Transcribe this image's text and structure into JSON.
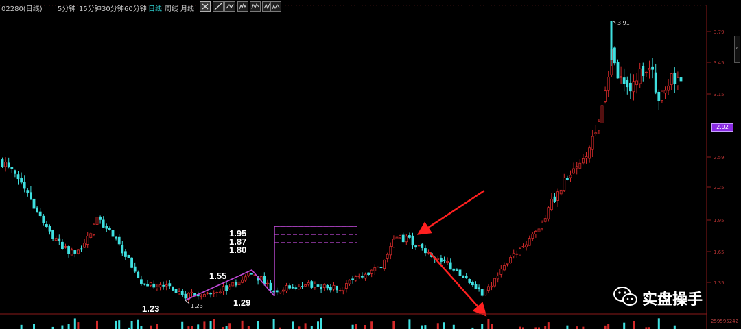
{
  "header": {
    "symbol_label": "02280(日线)",
    "periods": [
      {
        "label": "5分钟",
        "active": false
      },
      {
        "label": "15分钟",
        "active": false
      },
      {
        "label": "30分钟",
        "active": false
      },
      {
        "label": "60分钟",
        "active": false
      },
      {
        "label": "日线",
        "active": true
      },
      {
        "label": "周线",
        "active": false
      },
      {
        "label": "月线",
        "active": false
      }
    ],
    "drawing_tools": [
      "cursor-tool-icon",
      "line-tool-icon",
      "polyline-tool-icon",
      "wave-tool-icon",
      "wave-tool-icon",
      "wave-tool-icon",
      "wave-tool-icon"
    ]
  },
  "chart_data": {
    "type": "candlestick",
    "colors": {
      "up": "#d42a2a",
      "down": "#3fe0e0",
      "axis": "#8b1a1a",
      "annotation_line": "#c04ad8",
      "arrow": "#ff2020"
    },
    "y_axis_ticks": [
      "3.79",
      "3.45",
      "3.15",
      "2.59",
      "2.25",
      "1.95",
      "1.65",
      "1.35"
    ],
    "last_price": "2.92",
    "high_marker": "3.91",
    "low_marker": "1.23",
    "volume_label": "259595242",
    "annotations": {
      "low_label": "1.23",
      "swing_high": "1.55",
      "pullback_low": "1.29",
      "targets": [
        "1.95",
        "1.87",
        "1.80"
      ]
    }
  },
  "watermark": {
    "text": "实盘操手",
    "icon": "wechat-icon"
  }
}
